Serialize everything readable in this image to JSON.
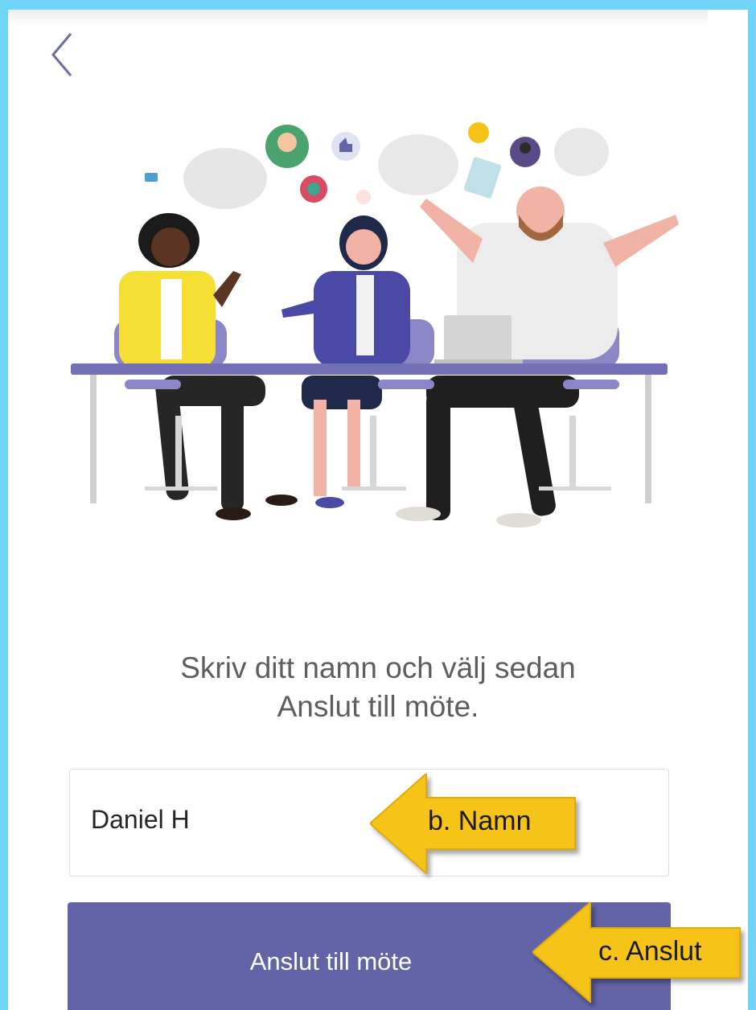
{
  "nav": {
    "back_icon": "chevron-left-icon"
  },
  "illustration": {
    "subject": "three-people-meeting-at-table"
  },
  "instruction": {
    "line1": "Skriv ditt namn och välj sedan",
    "line2": "Anslut till möte."
  },
  "name_field": {
    "value": "Daniel H"
  },
  "join_button": {
    "label": "Anslut till möte"
  },
  "annotations": {
    "name_callout": "b. Namn",
    "join_callout": "c. Anslut"
  },
  "colors": {
    "accent": "#6264a7",
    "callout": "#f6c418",
    "frame": "#6fd3f5"
  }
}
